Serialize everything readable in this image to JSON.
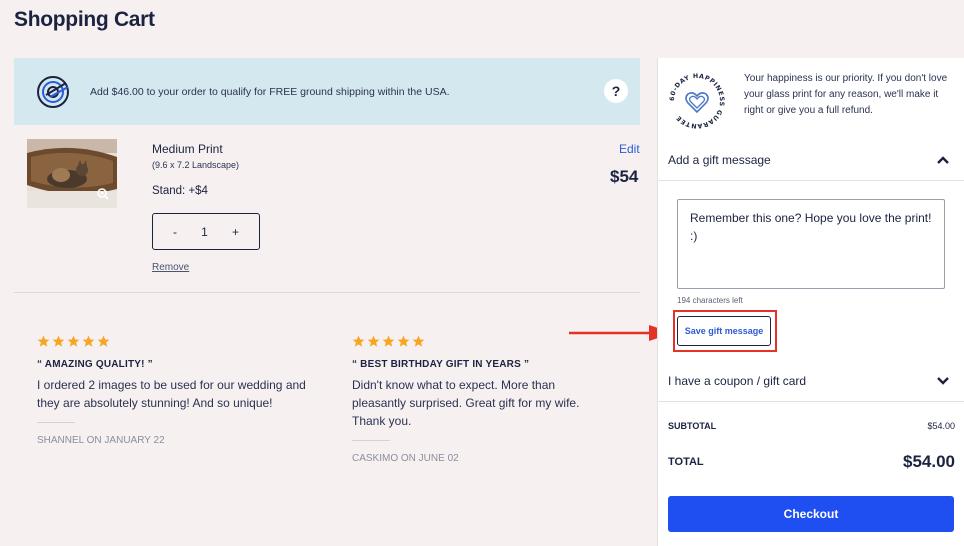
{
  "page": {
    "title": "Shopping Cart"
  },
  "shipping_banner": {
    "message": "Add $46.00 to your order to qualify for FREE ground shipping within the USA.",
    "help_label": "?",
    "icon": "shipping-globe-icon"
  },
  "cart_item": {
    "name": "Medium Print",
    "dimensions": "(9.6 x 7.2 Landscape)",
    "stand": "Stand: +$4",
    "qty_minus": "-",
    "quantity": "1",
    "qty_plus": "+",
    "remove_label": "Remove",
    "edit_label": "Edit",
    "price": "$54",
    "thumbnail": "cat-in-basket-photo"
  },
  "reviews": [
    {
      "stars": 5,
      "title": "“ AMAZING QUALITY! ”",
      "body": "I ordered 2 images to be used for our wedding and they are absolutely stunning! And so unique!",
      "author": "SHANNEL ON JANUARY 22"
    },
    {
      "stars": 5,
      "title": "“ BEST BIRTHDAY GIFT IN YEARS ”",
      "body": "Didn't know what to expect. More than pleasantly surprised. Great gift for my wife. Thank you.",
      "author": "CASKIMO ON JUNE 02"
    }
  ],
  "guarantee": {
    "badge_text": "60-DAY HAPPINESS GUARANTEE",
    "text": "Your happiness is our priority. If you don't love your glass print for any reason, we'll make it right or give you a full refund."
  },
  "gift": {
    "header": "Add a gift message",
    "message": "Remember this one? Hope you love the print! :)",
    "chars_left": "194 characters left",
    "save_label": "Save gift message"
  },
  "coupon": {
    "header": "I have a coupon / gift card"
  },
  "summary": {
    "subtotal_label": "SUBTOTAL",
    "subtotal_value": "$54.00",
    "total_label": "TOTAL",
    "total_value": "$54.00"
  },
  "checkout_label": "Checkout",
  "colors": {
    "navy": "#1b2340",
    "link_blue": "#2d5bd6",
    "checkout_blue": "#1f4ff0",
    "star_orange": "#f5a623",
    "banner_bg": "#d3e8ef",
    "annotation_red": "#e43325"
  }
}
